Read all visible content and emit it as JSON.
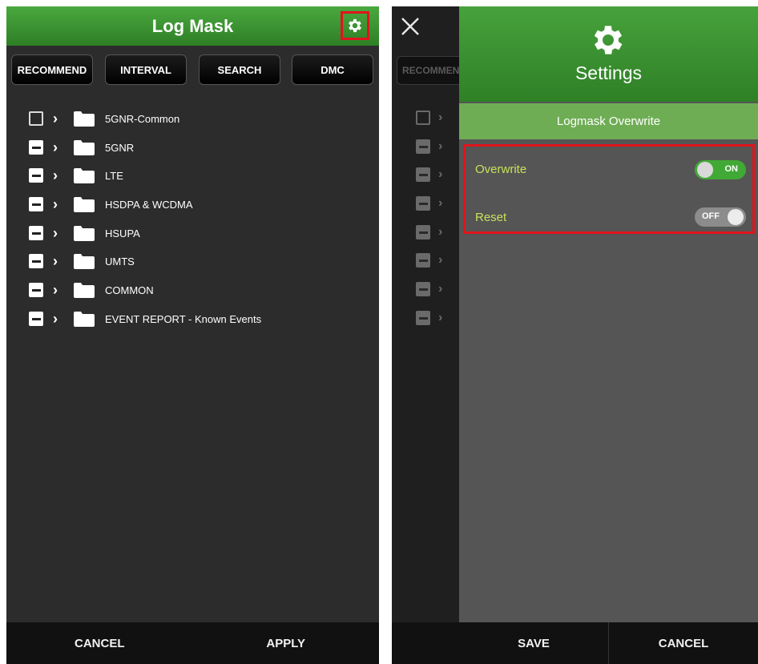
{
  "left_screen": {
    "title": "Log Mask",
    "settings_icon": "gear-icon",
    "tabs": [
      "RECOMMEND",
      "INTERVAL",
      "SEARCH",
      "DMC"
    ],
    "tree": [
      {
        "label": "5GNR-Common",
        "state": "unchecked"
      },
      {
        "label": "5GNR",
        "state": "partial"
      },
      {
        "label": "LTE",
        "state": "partial"
      },
      {
        "label": "HSDPA & WCDMA",
        "state": "partial"
      },
      {
        "label": "HSUPA",
        "state": "partial"
      },
      {
        "label": "UMTS",
        "state": "partial"
      },
      {
        "label": "COMMON",
        "state": "partial"
      },
      {
        "label": "EVENT REPORT - Known Events",
        "state": "partial"
      }
    ],
    "footer": {
      "cancel": "CANCEL",
      "apply": "APPLY"
    }
  },
  "right_screen": {
    "background_tab_label": "RECOMMEND",
    "drawer": {
      "title": "Settings",
      "section": "Logmask Overwrite",
      "options": [
        {
          "label": "Overwrite",
          "state": "ON"
        },
        {
          "label": "Reset",
          "state": "OFF"
        }
      ],
      "footer": {
        "save": "SAVE",
        "cancel": "CANCEL"
      }
    }
  },
  "colors": {
    "header_green": "#3a9531",
    "section_green": "#6fad55",
    "highlight_red": "#e0141c",
    "option_text": "#c7e25a",
    "toggle_on": "#41a935"
  }
}
